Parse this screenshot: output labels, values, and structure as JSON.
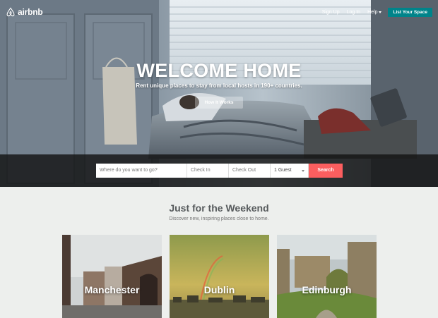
{
  "brand": {
    "name": "airbnb",
    "accent": "#fc5e5f",
    "teal": "#00848a"
  },
  "nav": {
    "sign_up": "Sign Up",
    "log_in": "Log In",
    "help": "Help",
    "list_space": "List Your Space"
  },
  "hero": {
    "headline": "WELCOME HOME",
    "subline": "Rent unique places to stay from local hosts in 190+ countries.",
    "how_it_works": "How It Works"
  },
  "search": {
    "where_placeholder": "Where do you want to go?",
    "check_in_placeholder": "Check In",
    "check_out_placeholder": "Check Out",
    "guests_value": "1 Guest",
    "search_label": "Search"
  },
  "weekend": {
    "title": "Just for the Weekend",
    "subtitle": "Discover new, inspiring places close to home.",
    "cities": [
      "Manchester",
      "Dublin",
      "Edinburgh"
    ]
  }
}
